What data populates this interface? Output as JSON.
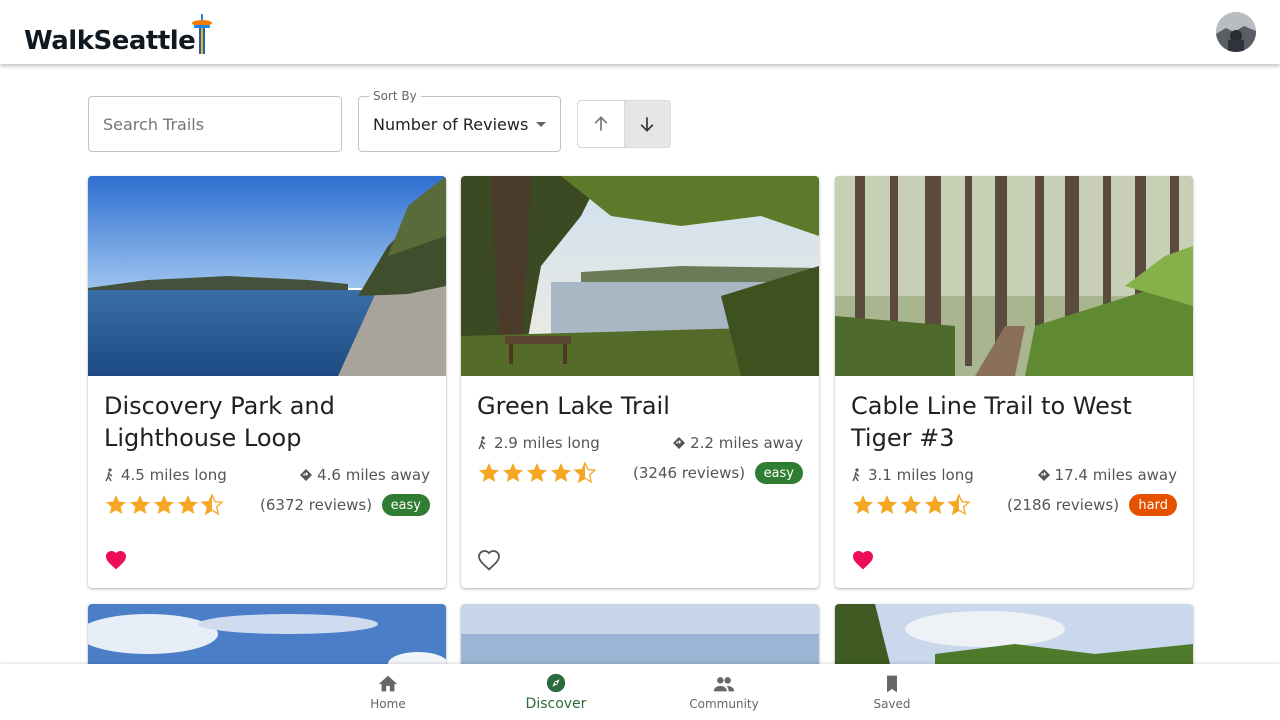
{
  "header": {
    "logo_text": "WalkSeattle",
    "avatar_alt": "User avatar"
  },
  "controls": {
    "search_placeholder": "Search Trails",
    "sort_label": "Sort By",
    "sort_value": "Number of Reviews",
    "order_options": [
      "ascending",
      "descending"
    ],
    "order_selected": "descending"
  },
  "trails": [
    {
      "title": "Discovery Park and Lighthouse Loop",
      "length": "4.5 miles long",
      "distance": "4.6 miles away",
      "rating": 4.5,
      "reviews": "(6372 reviews)",
      "difficulty": "easy",
      "saved": true
    },
    {
      "title": "Green Lake Trail",
      "length": "2.9 miles long",
      "distance": "2.2 miles away",
      "rating": 4.5,
      "reviews": "(3246 reviews)",
      "difficulty": "easy",
      "saved": false
    },
    {
      "title": "Cable Line Trail to West Tiger #3",
      "length": "3.1 miles long",
      "distance": "17.4 miles away",
      "rating": 4.5,
      "reviews": "(2186 reviews)",
      "difficulty": "hard",
      "saved": true
    }
  ],
  "nav": [
    {
      "label": "Home",
      "icon": "home-icon"
    },
    {
      "label": "Discover",
      "icon": "compass-icon",
      "active": true
    },
    {
      "label": "Community",
      "icon": "people-icon"
    },
    {
      "label": "Saved",
      "icon": "bookmark-icon"
    }
  ],
  "colors": {
    "accent": "#2e6b3c",
    "easy": "#2e7d32",
    "hard": "#e65100",
    "star": "#f5a623",
    "heart": "#ee0b5a"
  }
}
